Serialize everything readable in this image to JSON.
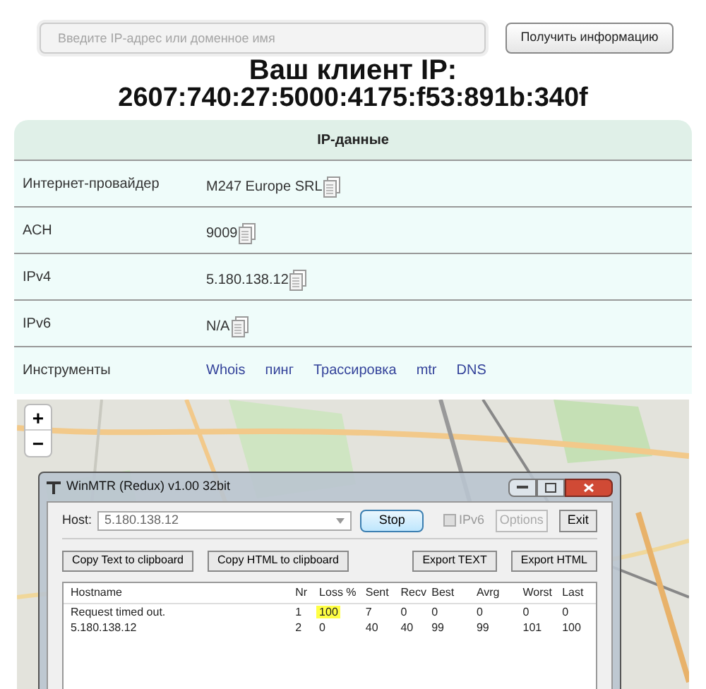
{
  "search": {
    "placeholder": "Введите IP-адрес или доменное имя",
    "button": "Получить информацию"
  },
  "client_ip": {
    "title": "Ваш клиент IP:",
    "address": "2607:740:27:5000:4175:f53:891b:340f"
  },
  "ip_table": {
    "header": "IP-данные",
    "rows": [
      {
        "label": "Интернет-провайдер",
        "value": "M247 Europe SRL",
        "kind": "copy"
      },
      {
        "label": "АСН",
        "value": "9009",
        "kind": "copy"
      },
      {
        "label": "IPv4",
        "value": "5.180.138.12",
        "kind": "copy"
      },
      {
        "label": "IPv6",
        "value": "N/A",
        "kind": "copy"
      },
      {
        "label": "Инструменты",
        "kind": "links",
        "links": [
          "Whois",
          "пинг",
          "Трассировка",
          "mtr",
          "DNS"
        ]
      }
    ]
  },
  "map": {
    "zoom_in": "+",
    "zoom_out": "−"
  },
  "winmtr": {
    "title": "WinMTR (Redux) v1.00 32bit",
    "host_label": "Host:",
    "host": "5.180.138.12",
    "stop": "Stop",
    "ipv6": {
      "label": "IPv6",
      "checked": false,
      "disabled": true
    },
    "options": {
      "label": "Options",
      "disabled": true
    },
    "exit": "Exit",
    "actions": [
      "Copy Text to clipboard",
      "Copy HTML to clipboard",
      "Export TEXT",
      "Export HTML"
    ],
    "columns": [
      "Hostname",
      "Nr",
      "Loss %",
      "Sent",
      "Recv",
      "Best",
      "Avrg",
      "Worst",
      "Last"
    ],
    "rows": [
      {
        "cells": [
          "Request timed out.",
          "1",
          "100",
          "7",
          "0",
          "0",
          "0",
          "0",
          "0"
        ],
        "loss_highlighted": true
      },
      {
        "cells": [
          "5.180.138.12",
          "2",
          "0",
          "40",
          "40",
          "99",
          "99",
          "101",
          "100"
        ],
        "loss_highlighted": false
      }
    ]
  }
}
